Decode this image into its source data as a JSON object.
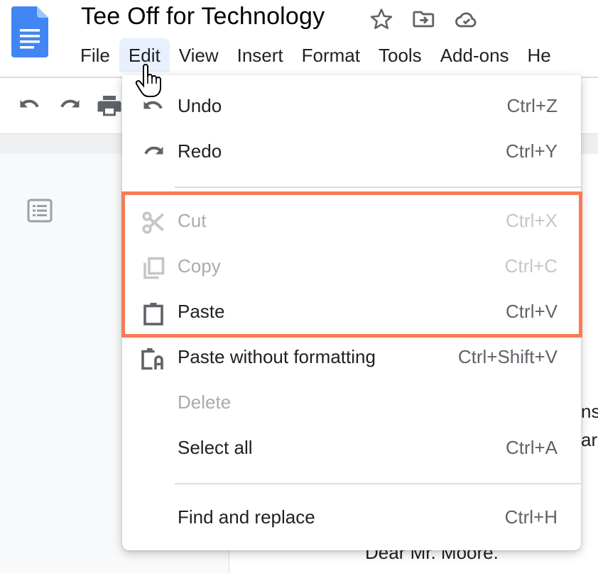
{
  "app": {
    "logo": "google-docs-logo",
    "title": "Tee Off for Technology",
    "header_icons": [
      "star-icon",
      "move-to-folder-icon",
      "cloud-saved-icon"
    ]
  },
  "menubar": {
    "items": [
      {
        "label": "File",
        "active": false
      },
      {
        "label": "Edit",
        "active": true
      },
      {
        "label": "View",
        "active": false
      },
      {
        "label": "Insert",
        "active": false
      },
      {
        "label": "Format",
        "active": false
      },
      {
        "label": "Tools",
        "active": false
      },
      {
        "label": "Add-ons",
        "active": false
      },
      {
        "label": "He",
        "active": false
      }
    ]
  },
  "toolbar": {
    "icons": [
      "undo-icon",
      "redo-icon",
      "print-icon"
    ]
  },
  "sidebar": {
    "icon": "document-outline-icon"
  },
  "document": {
    "visible_fragments": [
      "ns",
      "arc",
      "Dear Mr. Moore."
    ]
  },
  "edit_menu": {
    "items": [
      {
        "label": "Undo",
        "shortcut": "Ctrl+Z",
        "icon": "undo-icon",
        "enabled": true
      },
      {
        "label": "Redo",
        "shortcut": "Ctrl+Y",
        "icon": "redo-icon",
        "enabled": true
      },
      {
        "label": "Cut",
        "shortcut": "Ctrl+X",
        "icon": "scissors-icon",
        "enabled": false
      },
      {
        "label": "Copy",
        "shortcut": "Ctrl+C",
        "icon": "copy-icon",
        "enabled": false
      },
      {
        "label": "Paste",
        "shortcut": "Ctrl+V",
        "icon": "clipboard-icon",
        "enabled": true
      },
      {
        "label": "Paste without formatting",
        "shortcut": "Ctrl+Shift+V",
        "icon": "paste-plain-icon",
        "enabled": true
      },
      {
        "label": "Delete",
        "shortcut": "",
        "icon": "",
        "enabled": false
      },
      {
        "label": "Select all",
        "shortcut": "Ctrl+A",
        "icon": "",
        "enabled": true
      },
      {
        "label": "Find and replace",
        "shortcut": "Ctrl+H",
        "icon": "",
        "enabled": true
      }
    ],
    "highlight_color": "#f97b55",
    "highlighted_items": [
      "Cut",
      "Copy",
      "Paste"
    ]
  }
}
